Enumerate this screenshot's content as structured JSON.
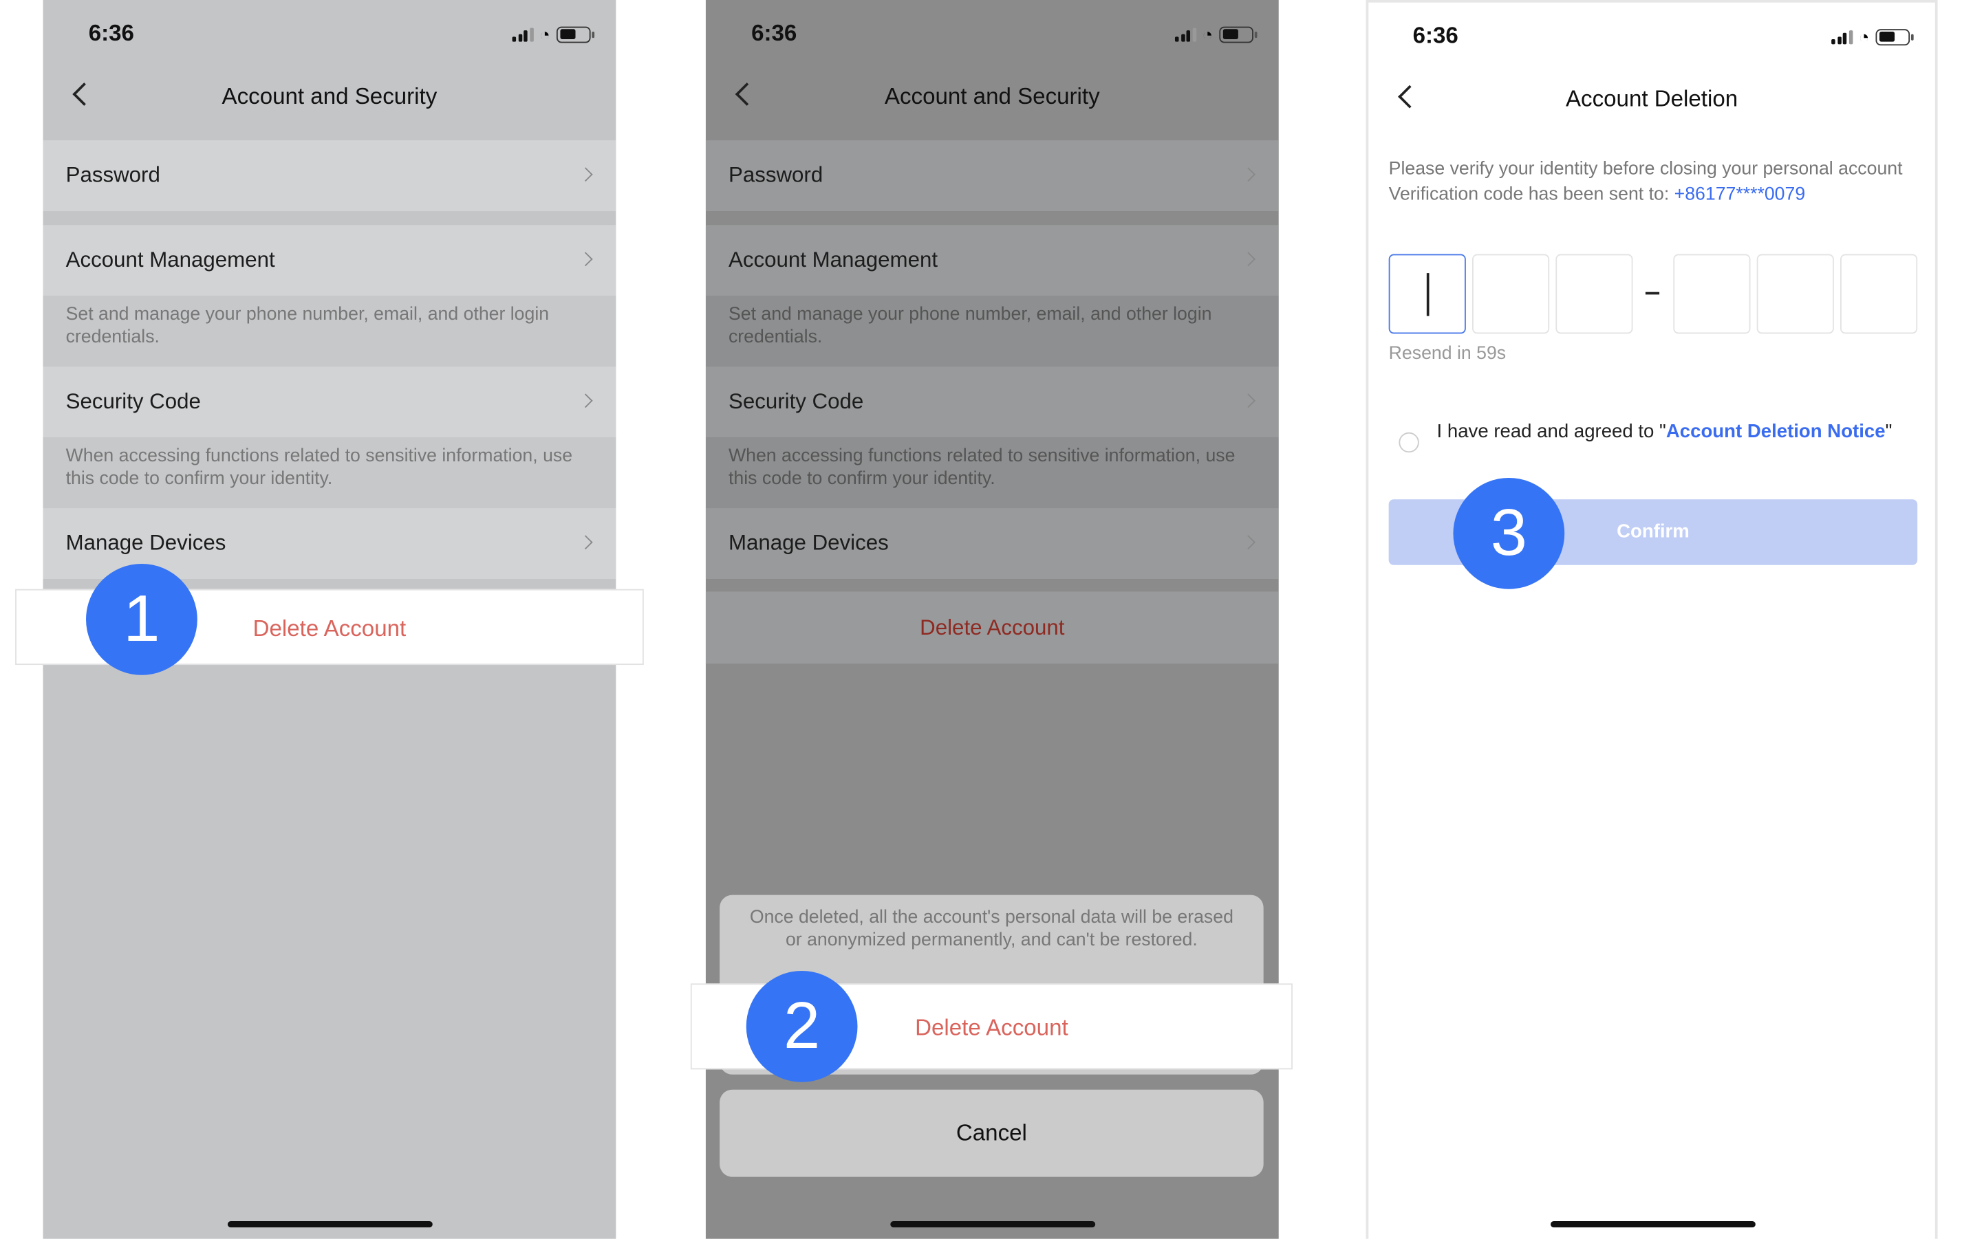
{
  "status": {
    "time": "6:36"
  },
  "screen1": {
    "title": "Account and Security",
    "rows": [
      {
        "label": "Password"
      },
      {
        "label": "Account Management",
        "desc": "Set and manage your phone number, email, and other login credentials."
      },
      {
        "label": "Security Code",
        "desc": "When accessing functions related to sensitive information, use this code to confirm your identity."
      },
      {
        "label": "Manage Devices"
      }
    ],
    "delete_label": "Delete Account",
    "step": "1"
  },
  "screen2": {
    "title": "Account and Security",
    "rows": [
      {
        "label": "Password"
      },
      {
        "label": "Account Management",
        "desc": "Set and manage your phone number, email, and other login credentials."
      },
      {
        "label": "Security Code",
        "desc": "When accessing functions related to sensitive information, use this code to confirm your identity."
      },
      {
        "label": "Manage Devices"
      }
    ],
    "delete_label": "Delete Account",
    "sheet": {
      "notice": "Once deleted, all the account's personal data will be erased or anonymized permanently, and can't be restored.",
      "delete_label": "Delete Account",
      "cancel_label": "Cancel"
    },
    "step": "2"
  },
  "screen3": {
    "title": "Account Deletion",
    "intro": "Please verify your identity before closing your personal account",
    "sent_label": "Verification code has been sent to: ",
    "phone": "+86177****0079",
    "resend": "Resend in 59s",
    "agree_prefix": "I have read and agreed to \"",
    "agree_link": "Account Deletion Notice",
    "agree_suffix": "\"",
    "confirm_label": "Confirm",
    "step": "3"
  },
  "colors": {
    "accent": "#3574f5",
    "danger": "#d9645c",
    "link": "#3a6cf0",
    "confirm_disabled": "#c0cdf5"
  }
}
